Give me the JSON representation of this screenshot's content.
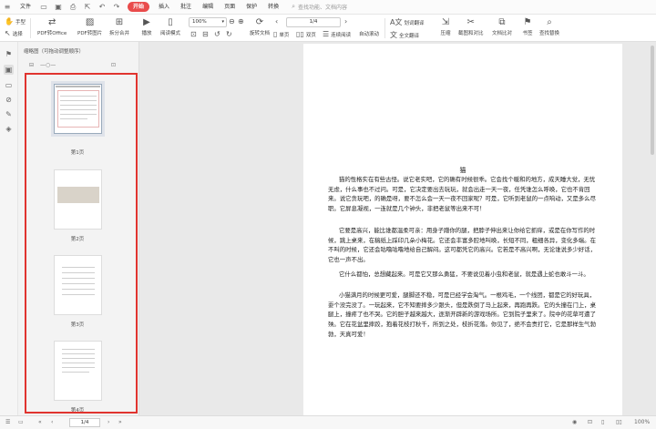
{
  "menubar": {
    "file_label": "文件",
    "tabs": [
      "开始",
      "插入",
      "批注",
      "编辑",
      "页面",
      "保护",
      "转换"
    ],
    "active_tab": "开始",
    "search_placeholder": "查找功能、文档内容"
  },
  "toolbar": {
    "hand": "手型",
    "select": "选择",
    "pdf_to_office": "PDF转Office",
    "pdf_to_image": "PDF转图片",
    "split_merge": "拆分合并",
    "play": "播放",
    "read_mode": "阅读模式",
    "zoom": "100%",
    "rotate": "旋转文档",
    "page_current": "1/4",
    "single": "单页",
    "double": "双页",
    "continuous": "连续阅读",
    "auto_scroll": "自动滚动",
    "translate": "划词翻译",
    "full_translate": "全文翻译",
    "compress": "压缩",
    "screenshot_compare": "截图和对比",
    "doc_compare": "文档比对",
    "bookmark": "书签",
    "find_replace": "查找替换"
  },
  "thumbnail_pane": {
    "title": "缩略图（可拖动调整顺序）",
    "pages": [
      "第1页",
      "第2页",
      "第3页",
      "第4页"
    ],
    "selected_page": "第1页"
  },
  "document": {
    "title": "猫",
    "paragraphs": [
      "猫的性格实在有些古怪。说它老实吧，它的确有时候很乖。它会找个暖和的地方，成天睡大觉，无忧无虑，什么事也不过问。可是，它决定要出去玩玩，就会出走一天一夜，任凭谁怎么呼唤，它也不肯回来。说它贪玩吧，的确是呀，要不怎么会一天一夜不回家呢？可是，它听到老鼠的一点响动，又是多么尽职。它屏息凝视，一连就是几个钟头，非把老鼠等出来不可！",
      "它要是高兴，能比谁都温柔可亲：用身子蹭你的腿，把脖子伸出来让你给它抓痒，或是在你写作的时候，跳上桌来，在稿纸上踩印几朵小梅花。它还会丰富多腔地叫唤，长短不同，粗细各异，变化多端。在不叫的时候，它还会咕噜咕噜地给自己解闷。这可都凭它的高兴。它若是不高兴啊，无论谁说多少好话，它也一声不出。",
      "它什么都怕，总想藏起来。可是它又那么勇猛，不要说见着小虫和老鼠，就是遇上蛇也敢斗一斗。",
      "小猫满月的时候更可爱，腿脚还不稳，可是已经学会淘气。一根鸡毛，一个线团，都是它的好玩具，耍个没完没了。一玩起来，它不知要摔多少跟头，但是跌倒了马上起来，再跑再跌。它的头撞在门上，桌腿上，撞疼了也不哭。它的胆子越来越大，逐渐开辟新的游戏场所。它到院子里来了。院中的花草可遭了殃。它在花盆里摔跤，抱着花枝打秋千，所到之处，枝折花落。你见了，绝不会责打它，它是那样生气勃勃，天真可爱！"
    ]
  },
  "statusbar": {
    "page_indicator": "1/4",
    "zoom": "100%"
  }
}
